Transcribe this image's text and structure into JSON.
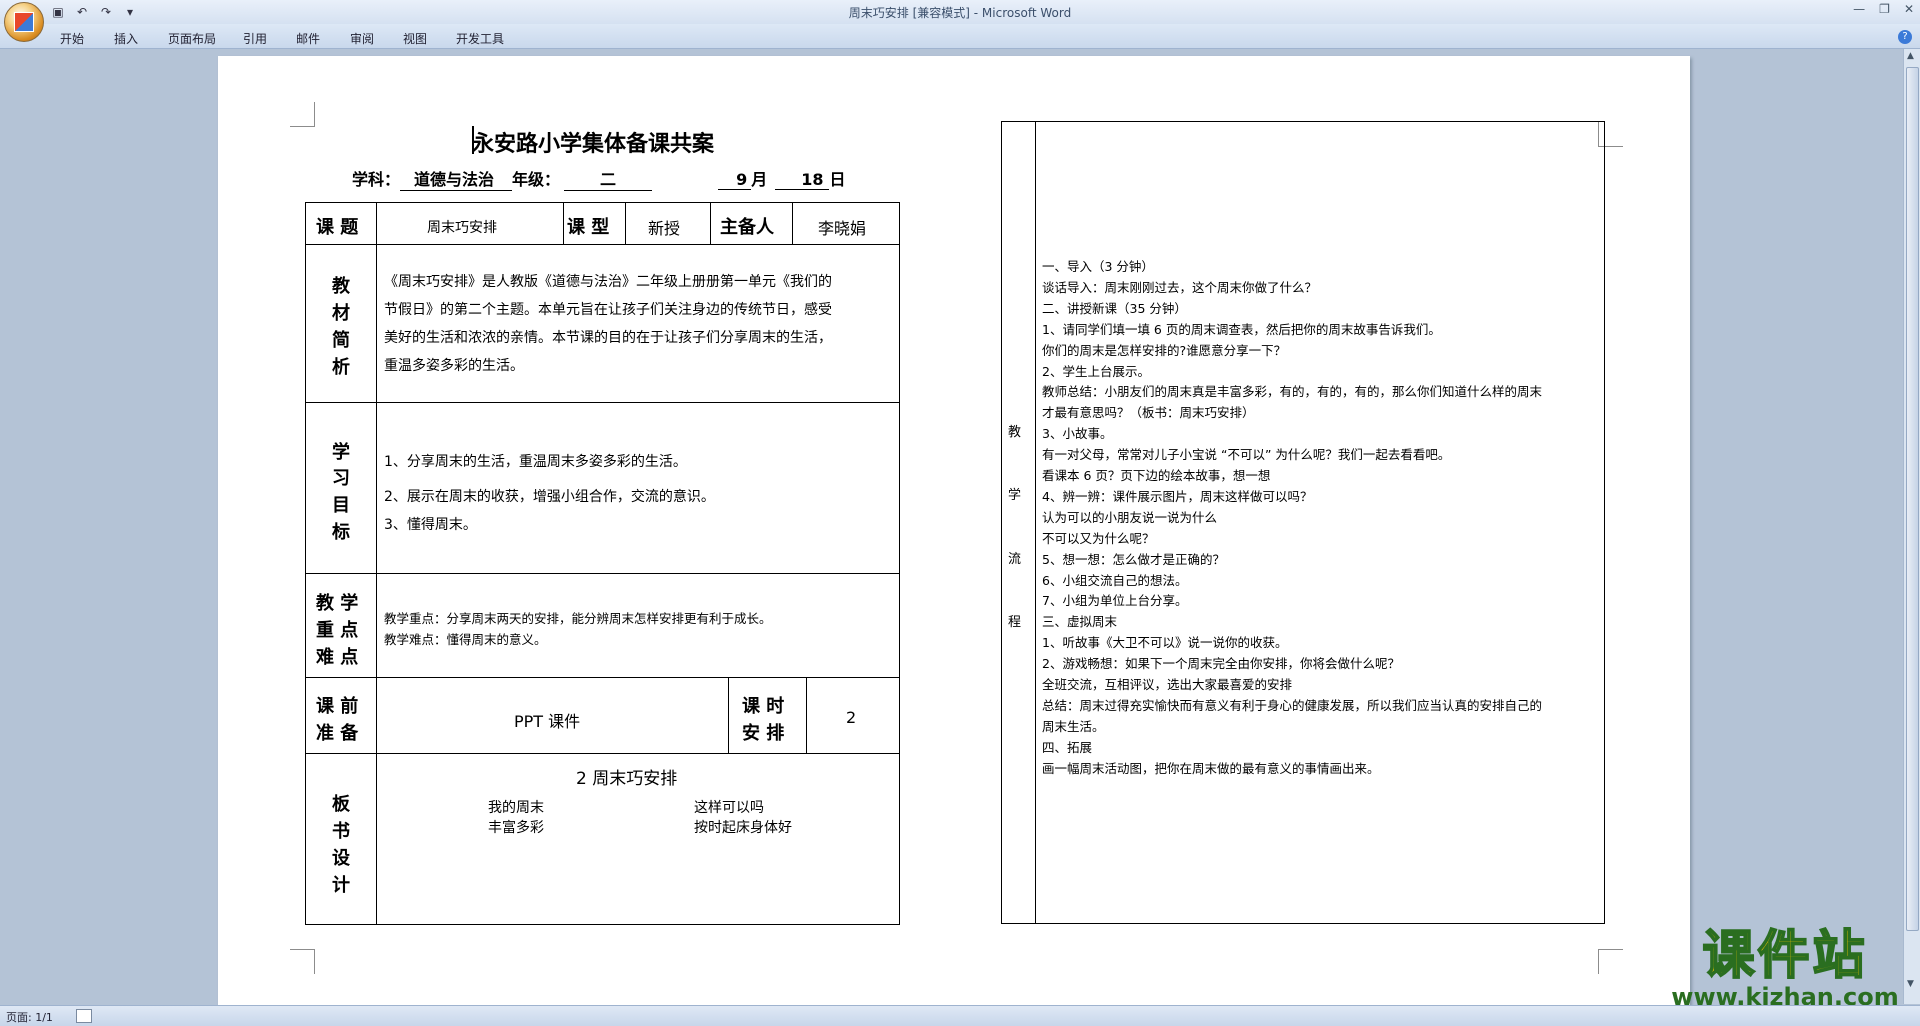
{
  "window": {
    "title": "周末巧安排 [兼容模式] - Microsoft Word"
  },
  "ribbon_tabs": [
    "开始",
    "插入",
    "页面布局",
    "引用",
    "邮件",
    "审阅",
    "视图",
    "开发工具"
  ],
  "status": {
    "page": "页面: 1/1"
  },
  "doc": {
    "title": "永安路小学集体备课共案",
    "subject_label": "学科：",
    "subject": "道德与法治",
    "grade_label": "年级：",
    "grade": "二",
    "month": "9",
    "month_label": "月",
    "day": "18",
    "day_label": "日",
    "topic_label": "课 题",
    "topic": "周末巧安排",
    "type_label": "课 型",
    "type": "新授",
    "lead_label": "主备人",
    "lead": "李晓娟",
    "analysis_label": [
      "教",
      "材",
      "简",
      "析"
    ],
    "analysis_lines": [
      "《周末巧安排》是人教版《道德与法治》二年级上册册第一单元《我们的",
      "节假日》的第二个主题。本单元旨在让孩子们关注身边的传统节日，感受",
      "美好的生活和浓浓的亲情。本节课的目的在于让孩子们分享周末的生活，",
      "重温多姿多彩的生活。"
    ],
    "goals_label": [
      "学",
      "习",
      "目",
      "标"
    ],
    "goals": [
      "1、分享周末的生活，重温周末多姿多彩的生活。",
      "2、展示在周末的收获，增强小组合作，交流的意识。",
      "3、懂得周末。"
    ],
    "key_label": [
      "教 学",
      "重 点",
      "难 点"
    ],
    "key_points": [
      "教学重点：分享周末两天的安排，能分辨周末怎样安排更有利于成长。",
      "教学难点：懂得周末的意义。"
    ],
    "prep_label": [
      "课 前",
      "准 备"
    ],
    "prep": "PPT 课件",
    "hours_label": [
      "课 时",
      "安 排"
    ],
    "hours": "2",
    "board_label": [
      "板",
      "书",
      "设",
      "计"
    ],
    "board_title": "2 周末巧安排",
    "board_left": [
      "我的周末",
      "丰富多彩"
    ],
    "board_right": [
      "这样可以吗",
      "按时起床身体好"
    ],
    "process_label": [
      "教",
      "学",
      "流",
      "程"
    ],
    "process_lines": [
      "一、导入（3 分钟）",
      "谈话导入：周末刚刚过去，这个周末你做了什么？",
      "二、讲授新课（35 分钟）",
      "1、请同学们填一填 6 页的周末调查表，然后把你的周末故事告诉我们。",
      "你们的周末是怎样安排的?谁愿意分享一下？",
      "2、学生上台展示。",
      "教师总结：小朋友们的周末真是丰富多彩，有的，有的，有的，那么你们知道什么样的周末",
      "才最有意思吗？（板书：周末巧安排）",
      "3、小故事。",
      "有一对父母，常常对儿子小宝说 “不可以” 为什么呢？我们一起去看看吧。",
      "看课本 6 页？页下边的绘本故事，想一想",
      "4、辨一辨：课件展示图片，周末这样做可以吗？",
      "认为可以的小朋友说一说为什么",
      "不可以又为什么呢？",
      "5、想一想：怎么做才是正确的？",
      "6、小组交流自己的想法。",
      "7、小组为单位上台分享。",
      "三、虚拟周末",
      "1、听故事《大卫不可以》说一说你的收获。",
      "2、游戏畅想：如果下一个周末完全由你安排，你将会做什么呢？",
      "全班交流，互相评议，选出大家最喜爱的安排",
      "总结：周末过得充实愉快而有意义有利于身心的健康发展，所以我们应当认真的安排自己的",
      "周末生活。",
      "四、拓展",
      "画一幅周末活动图，把你在周末做的最有意义的事情画出来。"
    ]
  },
  "watermark": {
    "text": "课件站",
    "url": "www.kjzhan.com"
  }
}
